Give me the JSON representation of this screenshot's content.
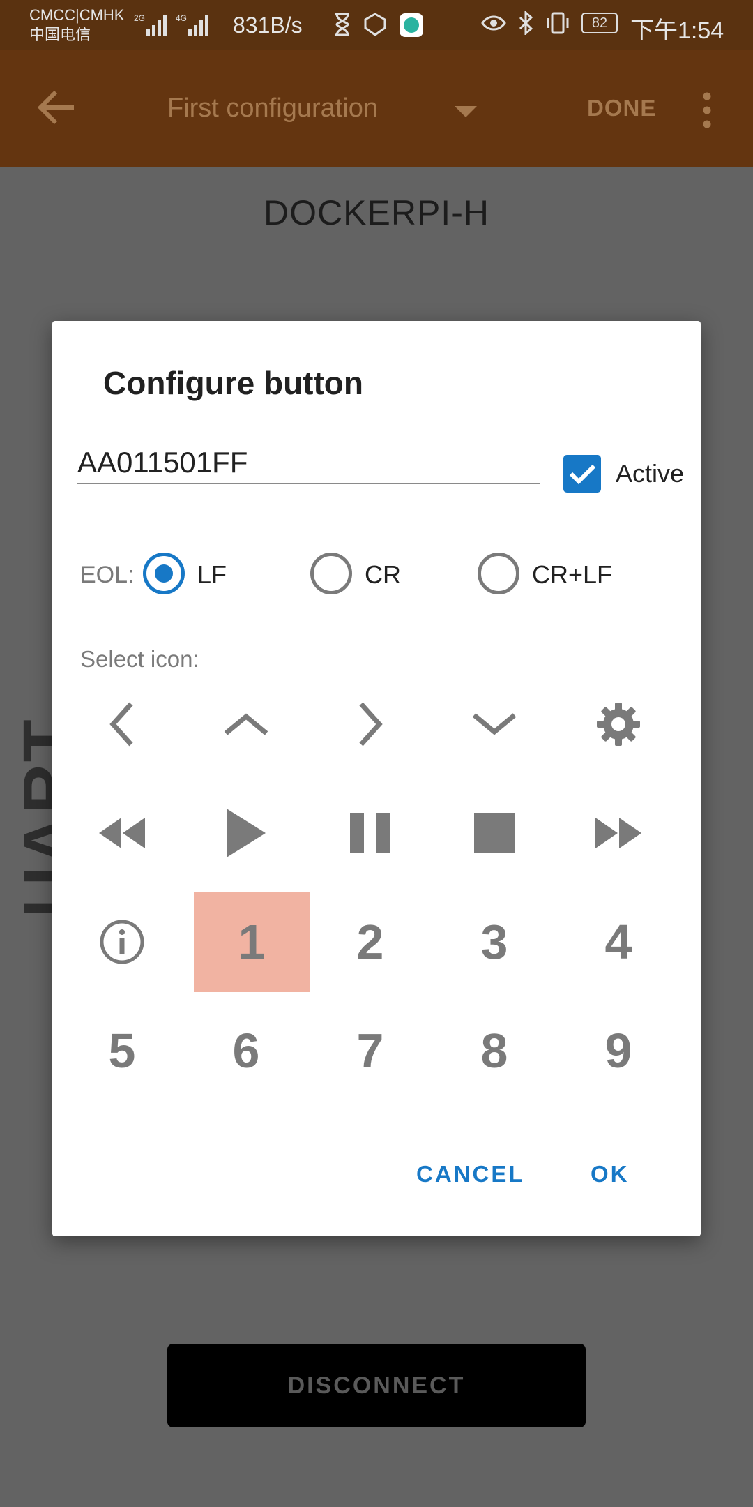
{
  "status_bar": {
    "carrier_line1": "CMCC|CMHK",
    "carrier_line2": "中国电信",
    "net_speed": "831B/s",
    "battery": "82",
    "time": "下午1:54"
  },
  "app_bar": {
    "title": "First configuration",
    "done_label": "DONE"
  },
  "screen": {
    "device_name": "DOCKERPI-H",
    "side_label": "UART",
    "disconnect_label": "DISCONNECT"
  },
  "dialog": {
    "title": "Configure button",
    "command_value": "AA011501FF",
    "active_label": "Active",
    "active_checked": true,
    "eol_label": "EOL:",
    "eol_options": [
      "LF",
      "CR",
      "CR+LF"
    ],
    "eol_selected": "LF",
    "select_icon_label": "Select icon:",
    "icons": [
      "chevron-left-icon",
      "chevron-up-icon",
      "chevron-right-icon",
      "chevron-down-icon",
      "gear-icon",
      "rewind-icon",
      "play-icon",
      "pause-icon",
      "stop-icon",
      "fast-forward-icon",
      "info-icon",
      "1",
      "2",
      "3",
      "4",
      "5",
      "6",
      "7",
      "8",
      "9"
    ],
    "selected_icon": "1",
    "cancel_label": "CANCEL",
    "ok_label": "OK"
  },
  "colors": {
    "app_bar": "#643510",
    "accent": "#1778c6",
    "selected_icon_bg": "#f1b3a2"
  }
}
